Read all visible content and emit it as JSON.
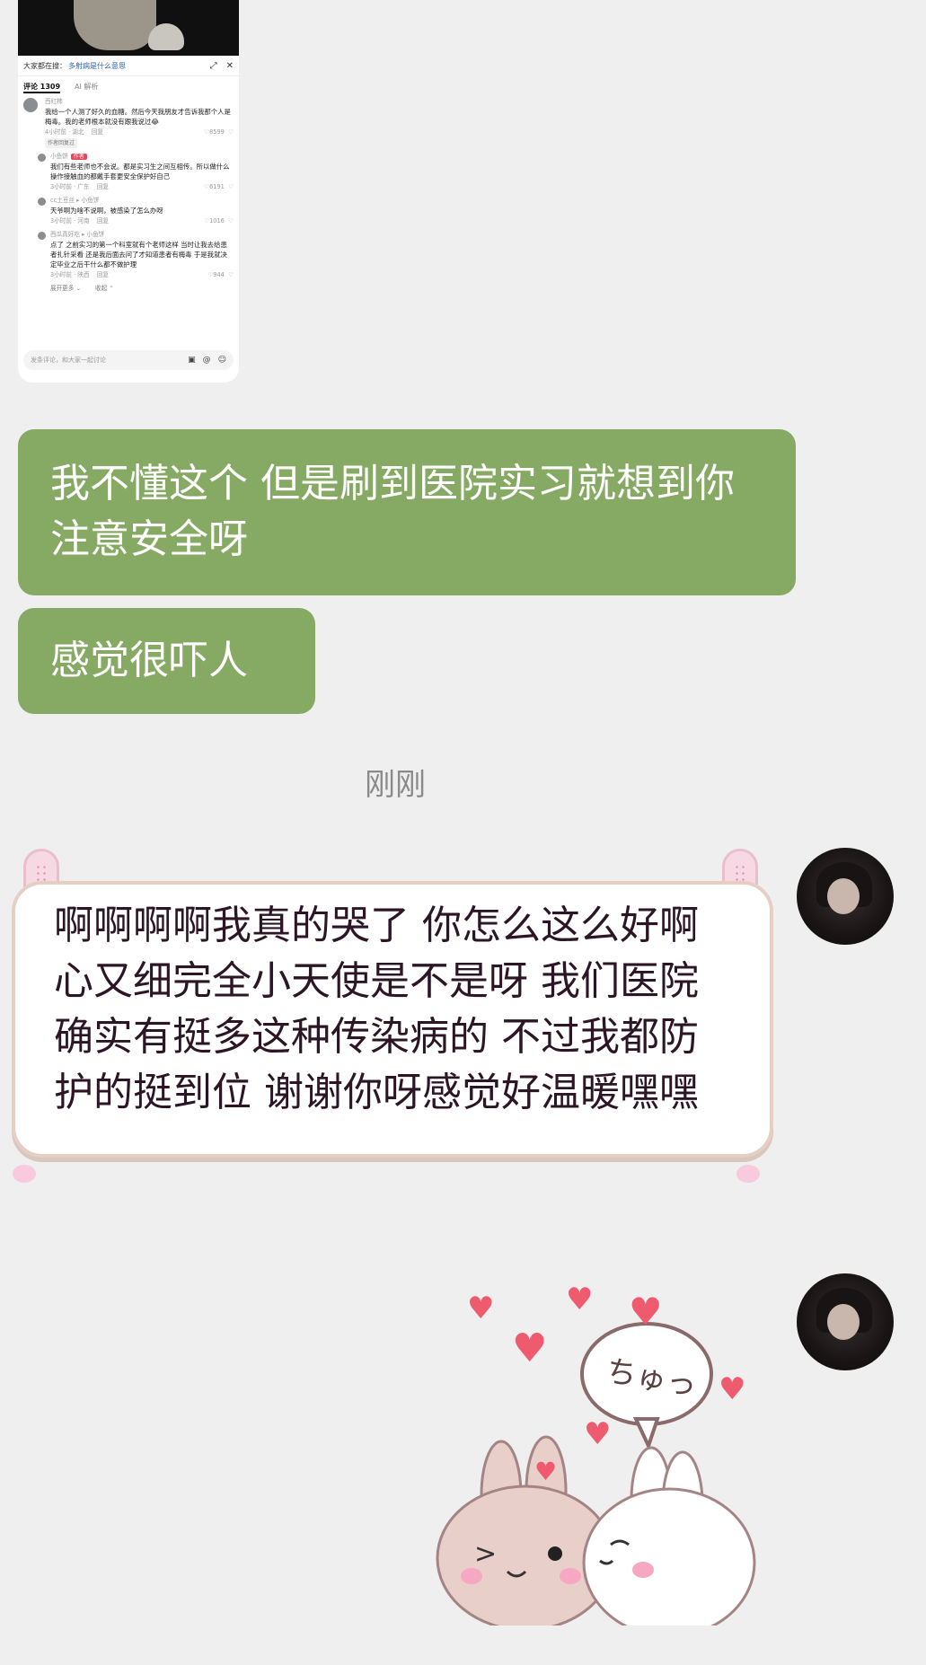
{
  "card": {
    "search_prefix": "大家都在搜：",
    "search_query": "多射病是什么意思",
    "tab_comments": "评论 1309",
    "tab_ai": "AI 解析",
    "comments": [
      {
        "name": "西红柿",
        "text": "我给一个人测了好久的血糖。然后今天我朋友才告诉我那个人是梅毒。我的老师根本就没有跟我说过😂",
        "meta": "4小时前 · 湖北",
        "reply": "回复",
        "likes": "8599",
        "pill": "作者回复过"
      }
    ],
    "replies": [
      {
        "name": "小鱼饼",
        "tag": "作者",
        "text": "我们有些老师也不会说。都是实习生之间互相传。所以做什么操作接触血的都戴手套更安全保护好自己",
        "meta": "3小时前 · 广东",
        "reply": "回复",
        "likes": "6191"
      },
      {
        "name": "cc土豆丝 ▸ 小鱼饼",
        "tag": "",
        "text": "天爷啊为啥不说啊，被感染了怎么办呀",
        "meta": "3小时前 · 河南",
        "reply": "回复",
        "likes": "1016"
      },
      {
        "name": "西瓜真好吃 ▸ 小鱼饼",
        "tag": "",
        "text": "点了 之前实习的第一个科室就有个老师这样 当时让我去给患者扎针采看 还是我后面去问了才知道患者有梅毒 于是我就决定毕业之后干什么都不做护理",
        "meta": "3小时前 · 陕西",
        "reply": "回复",
        "likes": "944"
      }
    ],
    "expand_more": "展开更多 ⌄",
    "collapse": "收起 ⌃",
    "input_placeholder": "发条评论，和大家一起讨论"
  },
  "messages": {
    "green_1": "我不懂这个 但是刷到医院实习就想到你 注意安全呀",
    "green_2": "感觉很吓人",
    "timestamp": "刚刚",
    "reply_text": "啊啊啊啊我真的哭了 你怎么这么好啊心又细完全小天使是不是呀 我们医院确实有挺多这种传染病的 不过我都防护的挺到位 谢谢你呀感觉好温暖嘿嘿"
  },
  "sticker": {
    "speech": "ちゅっ"
  },
  "colors": {
    "background": "#efefef",
    "green_bubble": "#86a964",
    "cute_border": "#e5cfc4",
    "cute_text": "#2c1626",
    "timestamp": "#8a8a8a"
  },
  "icons": [
    "share-icon",
    "close-icon",
    "heart-icon",
    "dislike-icon",
    "image-icon",
    "at-icon",
    "emoji-icon"
  ]
}
